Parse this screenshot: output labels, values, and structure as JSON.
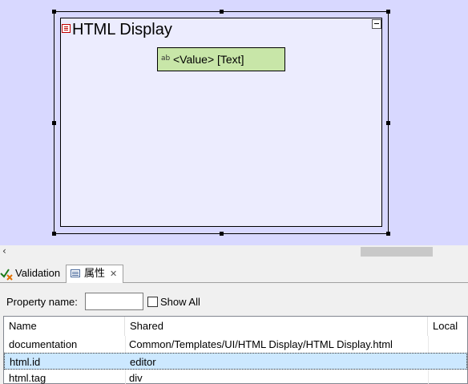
{
  "canvas": {
    "widget_title": "HTML Display",
    "value_text": "<Value> [Text]",
    "background_color": "#d8d8ff",
    "value_box_color": "#c8e6a8"
  },
  "tabs": [
    {
      "label": "Validation",
      "icon": "validation-icon",
      "active": false
    },
    {
      "label": "属性",
      "icon": "properties-icon",
      "active": true
    }
  ],
  "properties": {
    "filter_label": "Property name:",
    "filter_value": "",
    "show_all_label": "Show All",
    "show_all_checked": false,
    "columns": [
      "Name",
      "Shared",
      "Local"
    ],
    "rows": [
      {
        "name": "documentation",
        "shared": "Common/Templates/UI/HTML Display/HTML Display.html",
        "local": ""
      },
      {
        "name": "html.id",
        "shared": "editor",
        "local": "",
        "selected": true
      },
      {
        "name": "html.tag",
        "shared": "div",
        "local": ""
      }
    ]
  }
}
